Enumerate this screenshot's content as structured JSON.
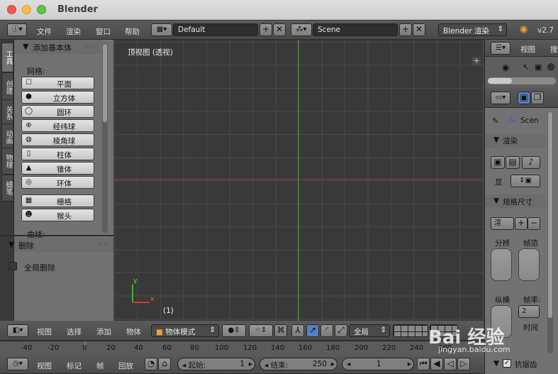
{
  "window": {
    "title": "Blender"
  },
  "info_header": {
    "menus": [
      "文件",
      "渲染",
      "窗口",
      "帮助"
    ],
    "layout_name": "Default",
    "scene_name": "Scene",
    "render_engine": "Blender 渲染",
    "version": "v2.7"
  },
  "tool_shelf": {
    "tabs": [
      "工具",
      "创建",
      "关系",
      "动画",
      "物理",
      "蜡笔"
    ],
    "add_primitive": {
      "title": "添加基本体",
      "mesh_label": "网格:",
      "mesh_items": [
        {
          "label": "平面",
          "icon": "plane-icon"
        },
        {
          "label": "立方体",
          "icon": "cube-icon"
        },
        {
          "label": "圆环",
          "icon": "circle-icon"
        },
        {
          "label": "经纬球",
          "icon": "uv-sphere-icon"
        },
        {
          "label": "棱角球",
          "icon": "ico-sphere-icon"
        },
        {
          "label": "柱体",
          "icon": "cylinder-icon"
        },
        {
          "label": "锥体",
          "icon": "cone-icon"
        },
        {
          "label": "环体",
          "icon": "torus-icon"
        }
      ],
      "extra_items": [
        {
          "label": "栅格",
          "icon": "grid-icon"
        },
        {
          "label": "猴头",
          "icon": "monkey-icon"
        }
      ],
      "curve_label": "曲线:"
    },
    "delete_panel": {
      "title": "删除",
      "global_delete_label": "全局删除"
    }
  },
  "viewport": {
    "view_name": "顶视图 (透视)",
    "frame_indicator": "(1)",
    "axis_y": "y",
    "axis_x": "x"
  },
  "view3d_header": {
    "menus": [
      "视图",
      "选择",
      "添加",
      "物体"
    ],
    "mode": "物体模式",
    "pivot_scope": "全局"
  },
  "timeline": {
    "ticks": [
      "-40",
      "-20",
      "0",
      "20",
      "40",
      "60",
      "80",
      "100",
      "120",
      "140",
      "160",
      "180",
      "200",
      "220",
      "240",
      "260"
    ]
  },
  "timeline_header": {
    "menus": [
      "视图",
      "标记",
      "帧",
      "回放"
    ],
    "start_label": "起始:",
    "start_value": "1",
    "end_label": "结束:",
    "end_value": "250",
    "current_frame": "1"
  },
  "outliner": {
    "view_label": "视图",
    "search_label": "搜"
  },
  "properties": {
    "scene_label": "Scen",
    "render_panel_title": "渲染",
    "display_label": "显",
    "dimensions_title": "规格尺寸",
    "preset_short": "渲",
    "resolution_label": "分辨",
    "frame_range_label": "帧范",
    "aspect_label": "纵横",
    "frame_rate_label": "帧率:",
    "frame_rate_value": "2",
    "time_label": "时间",
    "anti_alias_label": "抗锯齿"
  },
  "watermark": {
    "text": "Bai 经验",
    "subtext": "jingyan.baidu.com"
  }
}
